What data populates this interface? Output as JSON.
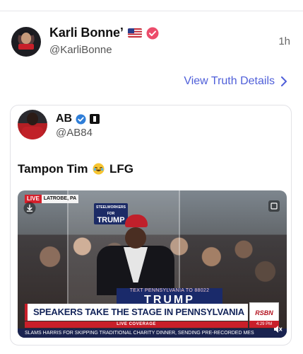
{
  "post": {
    "display_name": "Karli Bonne’",
    "handle": "@KarliBonne",
    "timestamp": "1h",
    "details_link": "View Truth Details"
  },
  "quote": {
    "display_name": "AB",
    "handle": "@AB84",
    "text_before": "Tampon Tim",
    "text_after": "LFG",
    "emoji": "laughing-emoji-icon"
  },
  "video": {
    "live_label": "LIVE",
    "location": "LATROBE, PA",
    "sign_line1": "STEELWORKERS",
    "sign_line2": "FOR",
    "sign_line3": "TRUMP",
    "podium_sub": "TEXT PENNSYLVANIA TO 88022",
    "podium_word": "TRUMP",
    "headline": "SPEAKERS TAKE THE STAGE IN PENNSYLVANIA",
    "live_coverage": "LIVE COVERAGE",
    "network": "RSBN",
    "time": "4:29 PM",
    "ticker": "SLAMS HARRIS FOR SKIPPING TRADITIONAL CHARITY DINNER, SENDING PRE-RECORDED MES"
  },
  "colors": {
    "link": "#4f5fd9",
    "verified": "#ec4c6b",
    "live_red": "#c91f2a"
  }
}
